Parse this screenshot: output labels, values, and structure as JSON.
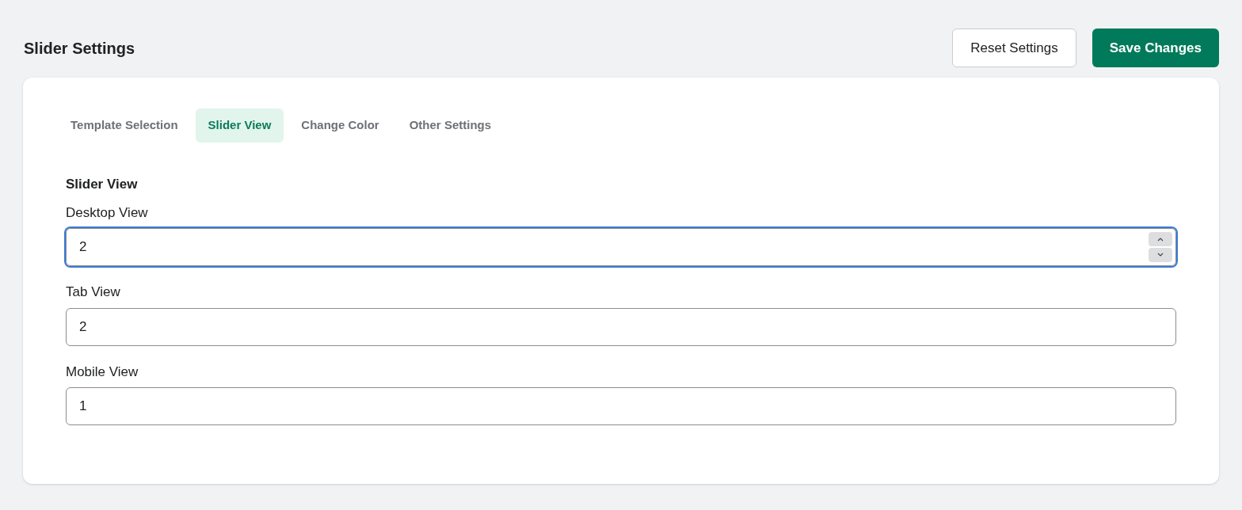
{
  "page": {
    "title": "Slider Settings"
  },
  "buttons": [
    {
      "label": "Reset Settings",
      "kind": "secondary"
    },
    {
      "label": "Save Changes",
      "kind": "primary"
    }
  ],
  "tabs": [
    {
      "label": "Template Selection",
      "selected": false
    },
    {
      "label": "Slider View",
      "selected": true
    },
    {
      "label": "Change Color",
      "selected": false
    },
    {
      "label": "Other Settings",
      "selected": false
    }
  ],
  "section": {
    "heading": "Slider View"
  },
  "fields": [
    {
      "label": "Desktop View",
      "value": "2",
      "focused": true
    },
    {
      "label": "Tab View",
      "value": "2",
      "focused": false
    },
    {
      "label": "Mobile View",
      "value": "1",
      "focused": false
    }
  ]
}
